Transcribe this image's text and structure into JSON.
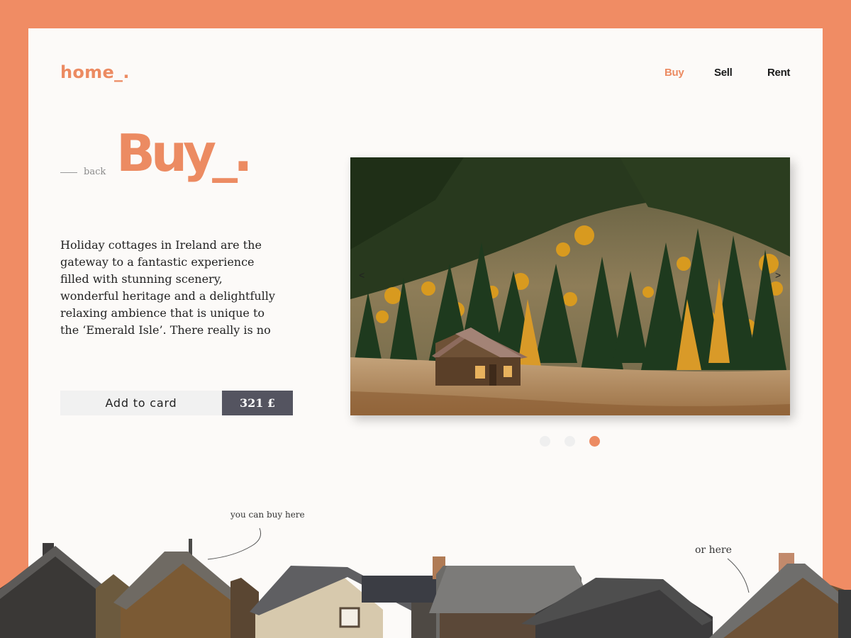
{
  "brand": {
    "logo": "home_."
  },
  "nav": {
    "items": [
      {
        "label": "Buy",
        "active": true
      },
      {
        "label": "Sell",
        "active": false
      },
      {
        "label": "Rent",
        "active": false
      }
    ]
  },
  "hero": {
    "back_label": "back",
    "title": "Buy_.",
    "description": "Holiday cottages in Ireland are the gateway to a fantastic experience filled with stunning scenery, wonderful heritage and a delightfully relaxing ambience that is unique to the ‘Emerald Isle’. There really is no",
    "add_button": "Add to card",
    "price": "321 £"
  },
  "carousel": {
    "prev": "<",
    "next": ">",
    "slides": 3,
    "active_slide": 3
  },
  "annotations": {
    "left": "you can buy here",
    "right": "or here"
  },
  "colors": {
    "accent": "#ec8b62",
    "frame": "#f08c64",
    "price_bg": "#545460"
  }
}
